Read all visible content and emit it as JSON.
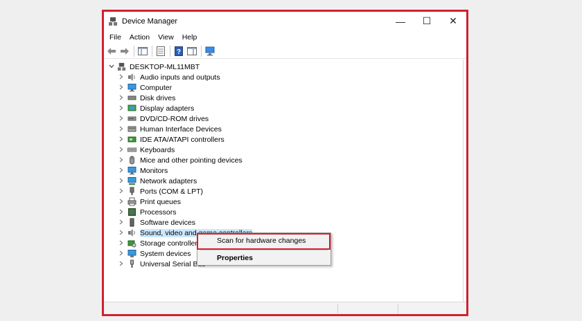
{
  "window": {
    "title": "Device Manager",
    "controls": {
      "minimize": "—",
      "maximize": "☐",
      "close": "✕"
    }
  },
  "menu": [
    "File",
    "Action",
    "View",
    "Help"
  ],
  "tree": {
    "root": "DESKTOP-ML11MBT",
    "items": [
      {
        "label": "Audio inputs and outputs",
        "icon": "speaker-icon"
      },
      {
        "label": "Computer",
        "icon": "monitor-icon"
      },
      {
        "label": "Disk drives",
        "icon": "disk-icon"
      },
      {
        "label": "Display adapters",
        "icon": "display-adapter-icon"
      },
      {
        "label": "DVD/CD-ROM drives",
        "icon": "dvd-icon"
      },
      {
        "label": "Human Interface Devices",
        "icon": "hid-icon"
      },
      {
        "label": "IDE ATA/ATAPI controllers",
        "icon": "ide-icon"
      },
      {
        "label": "Keyboards",
        "icon": "keyboard-icon"
      },
      {
        "label": "Mice and other pointing devices",
        "icon": "mouse-icon"
      },
      {
        "label": "Monitors",
        "icon": "monitor-icon"
      },
      {
        "label": "Network adapters",
        "icon": "network-icon"
      },
      {
        "label": "Ports (COM & LPT)",
        "icon": "port-icon"
      },
      {
        "label": "Print queues",
        "icon": "printer-icon"
      },
      {
        "label": "Processors",
        "icon": "processor-icon"
      },
      {
        "label": "Software devices",
        "icon": "software-device-icon"
      },
      {
        "label": "Sound, video and game controllers",
        "icon": "speaker-icon",
        "selected": true
      },
      {
        "label": "Storage controllers",
        "icon": "storage-icon"
      },
      {
        "label": "System devices",
        "icon": "system-icon"
      },
      {
        "label": "Universal Serial Bus",
        "icon": "usb-icon"
      }
    ]
  },
  "context_menu": {
    "scan": "Scan for hardware changes",
    "properties": "Properties"
  },
  "colors": {
    "highlight_frame": "#d1202f",
    "selection": "#cce8ff"
  }
}
